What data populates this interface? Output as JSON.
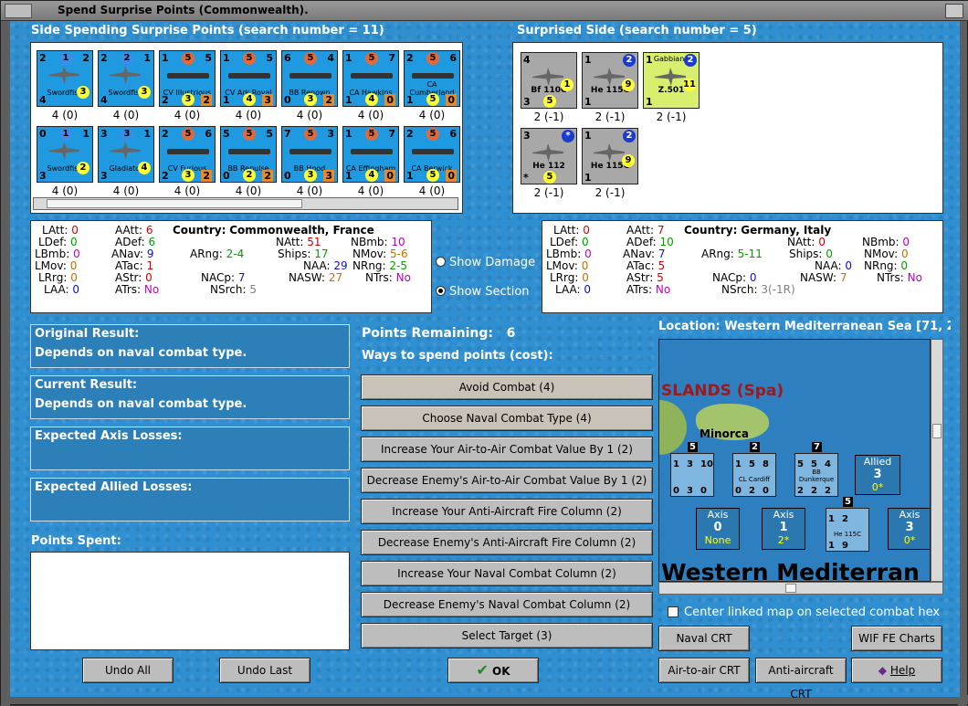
{
  "window": {
    "title": "Spend Surprise Points (Commonwealth)."
  },
  "spending": {
    "header": "Side Spending Surprise Points (search number = 11)",
    "units": [
      {
        "name": "Swordfish",
        "tl": "2",
        "tc": "1",
        "tr": "2",
        "bl": "4",
        "br": "3",
        "label": "4 (0)",
        "kind": "air"
      },
      {
        "name": "Swordfish",
        "tl": "2",
        "tc": "2",
        "tr": "1",
        "bl": "4",
        "br": "3",
        "label": "4 (0)",
        "kind": "air"
      },
      {
        "name": "CV Illustrious",
        "tl": "1",
        "tc": "5",
        "tr": "5",
        "bl": "2",
        "bc": "3",
        "br": "2",
        "label": "4 (0)",
        "kind": "ship"
      },
      {
        "name": "CV Ark Royal",
        "tl": "1",
        "tc": "5",
        "tr": "5",
        "bl": "1",
        "bc": "4",
        "br": "3",
        "label": "4 (0)",
        "kind": "ship"
      },
      {
        "name": "BB Renown",
        "tl": "6",
        "tc": "5",
        "tr": "4",
        "bl": "0",
        "bc": "3",
        "br": "2",
        "label": "4 (0)",
        "kind": "ship"
      },
      {
        "name": "CA Hawkins",
        "tl": "1",
        "tc": "5",
        "tr": "7",
        "bl": "1",
        "bc": "4",
        "br": "0",
        "label": "4 (0)",
        "kind": "ship"
      },
      {
        "name": "CA Cumberland",
        "tl": "2",
        "tc": "5",
        "tr": "6",
        "bl": "1",
        "bc": "5",
        "br": "0",
        "label": "4 (0)",
        "kind": "ship"
      },
      {
        "name": "Swordfish",
        "tl": "0",
        "tc": "1",
        "tr": "1",
        "bl": "3",
        "br": "2",
        "label": "4 (0)",
        "kind": "air"
      },
      {
        "name": "Gladiator",
        "tl": "3",
        "tc": "3",
        "tr": "1",
        "bl": "3",
        "br": "4",
        "label": "4 (0)",
        "kind": "air"
      },
      {
        "name": "CV Furious",
        "tl": "2",
        "tc": "5",
        "tr": "6",
        "bl": "2",
        "bc": "3",
        "br": "2",
        "label": "4 (0)",
        "kind": "ship"
      },
      {
        "name": "BB Repulse",
        "tl": "5",
        "tc": "5",
        "tr": "5",
        "bl": "0",
        "bc": "2",
        "br": "2",
        "label": "4 (0)",
        "kind": "ship"
      },
      {
        "name": "BB Hood",
        "tl": "7",
        "tc": "5",
        "tr": "3",
        "bl": "0",
        "bc": "3",
        "br": "3",
        "label": "4 (0)",
        "kind": "ship"
      },
      {
        "name": "CA Effingham",
        "tl": "1",
        "tc": "5",
        "tr": "7",
        "bl": "1",
        "bc": "4",
        "br": "0",
        "label": "4 (0)",
        "kind": "ship"
      },
      {
        "name": "CA Berwick",
        "tl": "2",
        "tc": "5",
        "tr": "6",
        "bl": "1",
        "bc": "5",
        "br": "0",
        "label": "4 (0)",
        "kind": "ship"
      }
    ]
  },
  "surprised": {
    "header": "Surprised Side (search number = 5)",
    "units": [
      {
        "name": "Bf 110C",
        "tl": "4",
        "bl": "3",
        "bc": "5",
        "br": "1",
        "label": "2 (-1)",
        "color": "gray"
      },
      {
        "name": "He 115C",
        "tl": "1",
        "tr": "2",
        "bl": "1",
        "br": "9",
        "label": "2 (-1)",
        "color": "gray"
      },
      {
        "name": "Z.501",
        "tl": "1",
        "tc": "Gabbiano",
        "tr": "2",
        "bl": "1",
        "br": "11",
        "label": "2 (-1)",
        "color": "yel"
      },
      {
        "name": "He 112",
        "tl": "3",
        "tr": "*",
        "bl": "*",
        "bc": "5",
        "label": "2 (-1)",
        "color": "gray"
      },
      {
        "name": "He 115C",
        "tl": "1",
        "tr": "2",
        "bl": "1",
        "br": "9",
        "label": "2 (-1)",
        "color": "gray"
      }
    ]
  },
  "stats_left": {
    "LAtt": "0",
    "AAtt": "6",
    "country_label": "Country:",
    "country": "Commonwealth, France",
    "NAtt": "51",
    "NBmb": "10",
    "LDef": "0",
    "ADef": "6",
    "LBmb": "0",
    "ANav": "9",
    "ARng": "2-4",
    "Ships": "17",
    "NMov": "5-6",
    "LMov": "0",
    "ATac": "1",
    "NAA": "29",
    "NRng": "2-5",
    "LRrg": "0",
    "AStr": "0",
    "NACp": "7",
    "NASW": "27",
    "NTrs": "No",
    "LAA": "0",
    "ATrs": "No",
    "NSrch": "5"
  },
  "stats_right": {
    "LAtt": "0",
    "AAtt": "7",
    "country_label": "Country:",
    "country": "Germany, Italy",
    "NAtt": "0",
    "NBmb": "0",
    "LDef": "0",
    "ADef": "10",
    "LBmb": "0",
    "ANav": "7",
    "ARng": "5-11",
    "Ships": "0",
    "NMov": "0",
    "LMov": "0",
    "ATac": "5",
    "NAA": "0",
    "NRng": "0",
    "LRrg": "0",
    "AStr": "5",
    "NACp": "0",
    "NASW": "7",
    "NTrs": "No",
    "LAA": "0",
    "ATrs": "No",
    "NSrch": "3(-1R)"
  },
  "radios": {
    "show_damage": "Show Damage",
    "show_section": "Show Section"
  },
  "results": {
    "original_label": "Original Result:",
    "original_value": "Depends on naval combat type.",
    "current_label": "Current Result:",
    "current_value": "Depends on naval combat type.",
    "axis_losses": "Expected Axis Losses:",
    "allied_losses": "Expected Allied Losses:",
    "points_spent": "Points Spent:"
  },
  "points": {
    "label": "Points Remaining:",
    "value": "6",
    "ways": "Ways to spend points (cost):"
  },
  "options": [
    "Avoid Combat (4)",
    "Choose Naval Combat Type (4)",
    "Increase Your Air-to-Air Combat Value By 1 (2)",
    "Decrease Enemy's Air-to-Air Combat Value By 1 (2)",
    "Increase Your Anti-Aircraft Fire Column (2)",
    "Decrease Enemy's Anti-Aircraft Fire Column (2)",
    "Increase Your Naval Combat Column (2)",
    "Decrease Enemy's Naval Combat Column (2)",
    "Select Target (3)"
  ],
  "buttons": {
    "undo_all": "Undo All",
    "undo_last": "Undo Last",
    "ok": "OK",
    "naval_crt": "Naval CRT",
    "wif_fe": "WIF FE Charts",
    "air_crt": "Air-to-air CRT",
    "aa_crt": "Anti-aircraft CRT",
    "help": "Help"
  },
  "map": {
    "location": "Location: Western Mediterranean Sea [71, 2",
    "region": "SLANDS (Spa)",
    "island": "Minorca",
    "sea": "Western Mediterran",
    "center_label": "Center linked map on selected combat hex",
    "allied_box": {
      "title": "Allied",
      "value": "3",
      "sub": "0*"
    },
    "axis_boxes": [
      {
        "title": "Axis",
        "value": "0",
        "sub": "None"
      },
      {
        "title": "Axis",
        "value": "1",
        "sub": "2*"
      },
      {
        "title": "Axis",
        "value": "3",
        "sub": "0*"
      }
    ],
    "map_units": [
      {
        "name": "",
        "top": "5",
        "a": "1",
        "b": "3",
        "c": "10",
        "d": "0",
        "e": "3",
        "f": "0"
      },
      {
        "name": "CL Cardiff",
        "top": "2",
        "a": "1",
        "b": "5",
        "c": "8",
        "d": "0",
        "e": "2",
        "f": "0"
      },
      {
        "name": "BB Dunkerque",
        "top": "7",
        "a": "5",
        "b": "5",
        "c": "4",
        "d": "2",
        "e": "2",
        "f": "2"
      },
      {
        "name": "He 115C",
        "top": "5",
        "a": "1",
        "b": "2",
        "c": "",
        "d": "1",
        "e": "9",
        "f": ""
      }
    ]
  }
}
